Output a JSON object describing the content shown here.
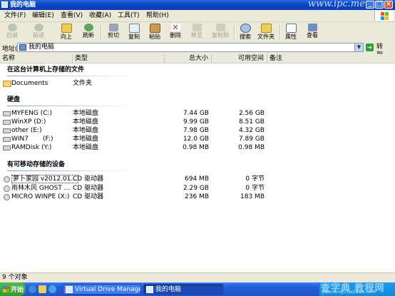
{
  "window": {
    "title": "我的电脑",
    "watermark": "www.ipc.me"
  },
  "menu": [
    "文件(F)",
    "编辑(E)",
    "查看(V)",
    "收藏(A)",
    "工具(T)",
    "帮助(H)"
  ],
  "toolbar": {
    "back": "后退",
    "forward": "前进",
    "up": "向上",
    "refresh": "刷新",
    "cut": "剪切",
    "copy": "复制",
    "paste": "粘贴",
    "delete": "删除",
    "move_to": "移至",
    "copy_to": "复制到",
    "search": "搜索",
    "folders": "文件夹",
    "properties": "属性",
    "views": "查看"
  },
  "address": {
    "label": "地址(D)",
    "value": "我的电脑",
    "go_label": "转到"
  },
  "columns": {
    "name": "名称",
    "type": "类型",
    "total_size": "总大小",
    "free_space": "可用空间",
    "comments": "备注"
  },
  "groups": {
    "stored": {
      "title": "在这台计算机上存储的文件",
      "items": [
        {
          "name": "Documents",
          "type": "文件夹",
          "icon": "folder-icon"
        }
      ]
    },
    "hard_disks": {
      "title": "硬盘",
      "items": [
        {
          "name": "MYFENG (C:)",
          "type": "本地磁盘",
          "total": "7.44 GB",
          "free": "2.56 GB",
          "icon": "hard-drive-icon"
        },
        {
          "name": "WinXP (D:)",
          "type": "本地磁盘",
          "total": "9.99 GB",
          "free": "8.51 GB",
          "icon": "hard-drive-icon"
        },
        {
          "name": "other (E:)",
          "type": "本地磁盘",
          "total": "7.98 GB",
          "free": "4.32 GB",
          "icon": "hard-drive-icon"
        },
        {
          "name": "WIN7       (F:)",
          "type": "本地磁盘",
          "total": "12.0 GB",
          "free": "7.89 GB",
          "icon": "hard-drive-icon"
        },
        {
          "name": "RAMDisk (Y:)",
          "type": "本地磁盘",
          "total": "0.98 MB",
          "free": "0.98 MB",
          "icon": "hard-drive-icon"
        }
      ]
    },
    "removable": {
      "title": "有可移动存储的设备",
      "items": [
        {
          "name": "萝卜家园 v2012.01...",
          "type": "CD 驱动器",
          "total": "694 MB",
          "free": "0 字节",
          "icon": "cd-drive-icon"
        },
        {
          "name": "雨林木风 GHOST ...",
          "type": "CD 驱动器",
          "total": "2.29 GB",
          "free": "0 字节",
          "icon": "cd-drive-icon"
        },
        {
          "name": "MICRO WINPE (X:)",
          "type": "CD 驱动器",
          "total": "236 MB",
          "free": "183 MB",
          "icon": "cd-drive-icon"
        }
      ]
    }
  },
  "status": "9 个对象",
  "taskbar": {
    "start": "开始",
    "tasks": [
      {
        "label": "Virtual Drive Manager ...",
        "active": false
      },
      {
        "label": "我的电脑",
        "active": true
      }
    ],
    "tray_watermark": "查字典 教程网",
    "tray_watermark_url": "jiaocheng.chazidian.com"
  },
  "colors": {
    "titlebar": "#0a47c9",
    "chrome": "#ece9d8",
    "taskbar": "#245edb",
    "start_button": "#3c9e3c"
  }
}
